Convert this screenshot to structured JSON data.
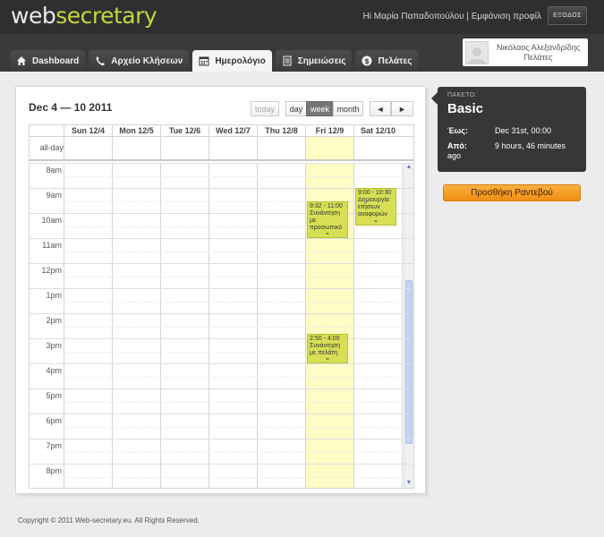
{
  "header": {
    "logo_part1": "web",
    "logo_part2": "secretary",
    "greeting": "Hi Μαρία Παπαδοπούλου | Εμφάνιση προφίλ",
    "logout_label": "ΕΞΟΔΟΣ"
  },
  "nav": {
    "tabs": [
      {
        "label": "Dashboard",
        "icon": "home-icon"
      },
      {
        "label": "Αρχείο Κλήσεων",
        "icon": "phone-icon"
      },
      {
        "label": "Ημερολόγιο",
        "icon": "calendar-icon"
      },
      {
        "label": "Σημειώσεις",
        "icon": "notes-icon"
      },
      {
        "label": "Πελάτες",
        "icon": "dollar-icon"
      }
    ],
    "active_tab": "Ημερολόγιο",
    "profile_name_line1": "Νικόλαος Αλεξανδρίδης",
    "profile_name_line2": "Πελάτες"
  },
  "calendar": {
    "title": "Dec 4 — 10 2011",
    "today_label": "today",
    "view_day": "day",
    "view_week": "week",
    "view_month": "month",
    "active_view": "week",
    "prev_icon": "◄",
    "next_icon": "►",
    "days": [
      "Sun 12/4",
      "Mon 12/5",
      "Tue 12/6",
      "Wed 12/7",
      "Thu 12/8",
      "Fri 12/9",
      "Sat 12/10"
    ],
    "today_day": "Fri 12/9",
    "allday_label": "all-day",
    "hours": [
      "8am",
      "9am",
      "10am",
      "11am",
      "12pm",
      "1pm",
      "2pm",
      "3pm",
      "4pm",
      "5pm",
      "6pm",
      "7pm",
      "8pm"
    ],
    "events": [
      {
        "time": "9:32 - 11:00",
        "title": "Συνάντηση με προσωπικό",
        "day": "Fri 12/9"
      },
      {
        "time": "9:00 - 10:30",
        "title": "Δημιουργία ετήσιων αναφορών",
        "day": "Sat 12/10"
      },
      {
        "time": "2:50 - 4:00",
        "title": "Συνάντηση με πελάτη",
        "day": "Fri 12/9"
      }
    ]
  },
  "package": {
    "label": "ΠΑΚΕΤΟ:",
    "name": "Basic",
    "until_label": "Έως:",
    "until_value": "Dec 31st, 00:00",
    "since_label": "Από:",
    "since_value": "9 hours, 46 minutes",
    "since_suffix": "ago"
  },
  "cta_label": "Προσθήκη Ραντεβού",
  "footer": "Copyright © 2011 Web-secretary.eu. All Rights Reserved.",
  "colors": {
    "accent": "#c6d63a",
    "event": "#d8df55",
    "today": "#fffcc6",
    "cta": "#f5a024"
  }
}
